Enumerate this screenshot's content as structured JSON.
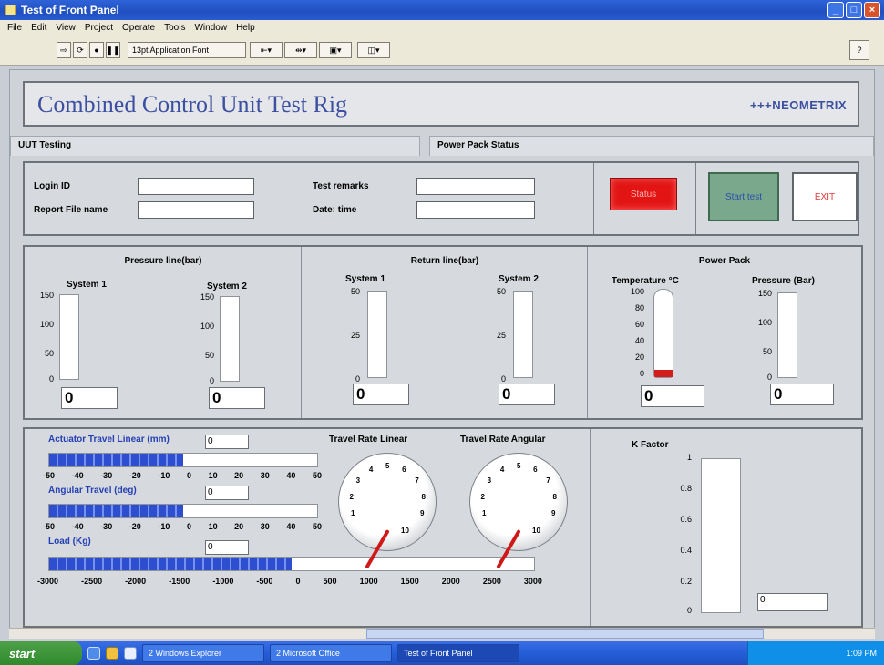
{
  "window": {
    "title": "Test of Front Panel"
  },
  "menu": [
    "File",
    "Edit",
    "View",
    "Project",
    "Operate",
    "Tools",
    "Window",
    "Help"
  ],
  "toolbar": {
    "font": "13pt Application Font"
  },
  "header": {
    "title": "Combined Control Unit Test Rig",
    "brand": "+++NEOMETRIX"
  },
  "tabs": {
    "left": "UUT Testing",
    "right": "Power Pack Status"
  },
  "login": {
    "login_id_label": "Login ID",
    "report_label": "Report File name",
    "remarks_label": "Test remarks",
    "datetime_label": "Date: time",
    "status_button": "Status",
    "start_button": "Start test",
    "exit_button": "EXIT"
  },
  "pressure": {
    "title": "Pressure line(bar)",
    "sys1": "System 1",
    "sys2": "System 2",
    "ticks": [
      "150",
      "100",
      "50",
      "0"
    ],
    "value1": "0",
    "value2": "0"
  },
  "return_line": {
    "title": "Return line(bar)",
    "sys1": "System 1",
    "sys2": "System 2",
    "ticks": [
      "50",
      "25",
      "0"
    ],
    "value1": "0",
    "value2": "0"
  },
  "power_pack": {
    "title": "Power Pack",
    "temp_label": "Temperature °C",
    "pressure_label": "Pressure  (Bar)",
    "temp_ticks": [
      "100",
      "80",
      "60",
      "40",
      "20",
      "0"
    ],
    "pressure_ticks": [
      "150",
      "100",
      "50",
      "0"
    ],
    "temp_value": "0",
    "pressure_value": "0",
    "temp_fill_fraction": 0.08
  },
  "travel": {
    "linear_label": "Actuator Travel Linear (mm)",
    "linear_value": "0",
    "linear_axis": [
      "-50",
      "-40",
      "-30",
      "-20",
      "-10",
      "0",
      "10",
      "20",
      "30",
      "40",
      "50"
    ],
    "angular_label": "Angular Travel (deg)",
    "angular_value": "0",
    "angular_axis": [
      "-50",
      "-40",
      "-30",
      "-20",
      "-10",
      "0",
      "10",
      "20",
      "30",
      "40",
      "50"
    ],
    "load_label": "Load (Kg)",
    "load_value": "0",
    "load_axis": [
      "-3000",
      "-2500",
      "-2000",
      "-1500",
      "-1000",
      "-500",
      "0",
      "500",
      "1000",
      "1500",
      "2000",
      "2500",
      "3000"
    ],
    "linear_fill_fraction": 0.5,
    "angular_fill_fraction": 0.5,
    "load_fill_fraction": 0.5
  },
  "dials": {
    "linear_title": "Travel Rate Linear",
    "angular_title": "Travel Rate Angular",
    "linear_unit": "10",
    "angular_unit": "10",
    "numbers": [
      "1",
      "2",
      "3",
      "4",
      "5",
      "6",
      "7",
      "8",
      "9"
    ]
  },
  "kfactor": {
    "title": "K Factor",
    "ticks": [
      "1",
      "0.8",
      "0.6",
      "0.4",
      "0.2",
      "0"
    ],
    "value": "0"
  },
  "taskbar": {
    "start": "start",
    "tasks": [
      "2 Windows Explorer",
      "2 Microsoft Office",
      "Test of Front Panel"
    ],
    "clock": "1:09 PM"
  }
}
